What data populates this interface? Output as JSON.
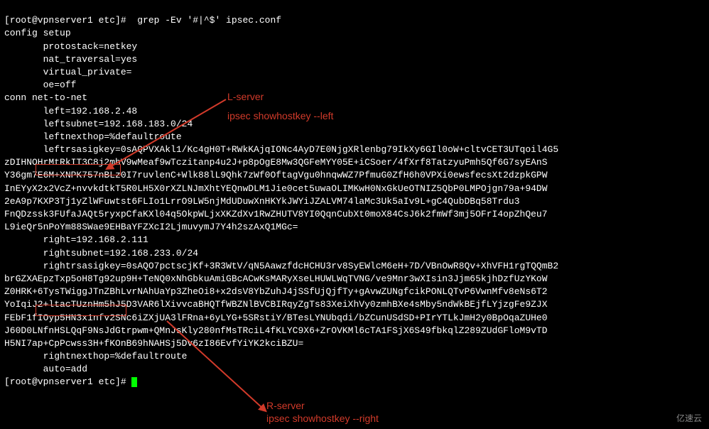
{
  "term": {
    "l0": "[root@vpnserver1 etc]#  grep -Ev '#|^$' ipsec.conf",
    "l1": "config setup",
    "l2": "       protostack=netkey",
    "l3": "       nat_traversal=yes",
    "l4": "       virtual_private=",
    "l5": "       oe=off",
    "l6": "conn net-to-net",
    "l7": "       left=192.168.2.48",
    "l8": "       leftsubnet=192.168.183.0/24",
    "l9": "       leftnexthop=%defaultroute",
    "l10a": "       leftrsasigkey=",
    "l10b": "0sAQPVXAkl1/Kc4gH0T+RWkKAjqIONc4AyD7E0NjgXRlenbg79IkXy6GIl0oW+cltvCET3UTqoil4G5",
    "l11": "zDIHNOHrMtRkIT3C8j2mhV9wMeaf9wTczitanp4u2J+p8pOgE8Mw3QGFeMYY05E+iCSoer/4fXrf8TatzyuPmh5Qf6G7syEAnS",
    "l12": "Y36gm7E6M+XNPK757nBLz0I7ruvlenC+Wlk88lL9Qhk7zWf0OftagVgu0hnqwWZ7PfmuG0ZfH6h0VPXi0ewsfecsXt2dzpkGPW",
    "l13": "InEYyX2x2VcZ+nvvkdtkT5R0LH5X0rXZLNJmXhtYEQnwDLM1Jie0cet5uwaOLIMKwH0NxGkUeOTNIZ5QbP0LMPOjgn79a+94DW",
    "l14": "2eA9p7KXP3Tj1yZlWFuwtst6FLIo1LrrO9LW5njMdUDuwXnHKYkJWYiJZALVM74laMc3Uk5aIv9L+gC4QubDBq58Trdu3",
    "l15": "FnQDzssk3FUfaJAQt5ryxpCfaKXl04q5OkpWLjxXKZdXv1RwZHUTV8YI0QqnCubXt0moX84CsJ6k2fmWf3mj5OFrI4opZhQeu7",
    "l16": "L9ieQr5nPoYm88SWae9EHBaYFZXcI2LjmuvymJ7Y4h2szAxQ1MGc=",
    "l17": "       right=192.168.2.111",
    "l18": "       rightsubnet=192.168.233.0/24",
    "l19a": "       rightrsasigkey=",
    "l19b": "0sAQO7pctscjKf+3R3WtV/qN5AawzfdcHCHU3rv8SyEWlcM6eH+7D/VBnOwR8Qv+XhVFH1rgTQQmB2",
    "l20": "brGZXAEpzTxp5oH8Tg92up9H+TeNQ0xNhGbkuAmiGBcACwKsMARyXseLHUWLWqTVNG/ve9Mnr3wXIsin3Jjm65kjhDzfUzYKoW",
    "l21": "Z0HRK+6TysTWiggJTnZBhLvrNAhUaYp3ZheOi8+x2dsV8YbZuhJ4jSSfUjQjfTy+gAvwZUNgfcikPONLQTvP6VwnMfv8eNs6T2",
    "l22": "YoIqiJ2+ltacTUznHm5hJ5D3VAR6lXivvcaBHQTfWBZNlBVCBIRqyZgTs83XeiXhVy0zmhBXe4sMby5ndWkBEjfLYjzgFe9ZJX",
    "l23": "FEbF1fIOyp5HN3x1nfv2SNc6iZXjUA3lFRna+6yLYG+5SRstiY/BTesLYNUbqdi/bZCunUSdSD+PIrYTLkJmH2y0BpOqaZUHe0",
    "l24": "J60D0LNfnHSLQqF9NsJdGtrpwm+QMnJsKly280nfMsTRciL4fKLYC9X6+ZrOVKMl6cTA1FSjX6S49fbkqlZ289ZUdGFloM9vTD",
    "l25": "H5NI7ap+CpPcwss3H+fKOnB69hNAHSj5Dv6zI86EvfYiYK2kciBZU=",
    "l26": "       rightnexthop=%defaultroute",
    "l27": "       auto=add",
    "l28": "[root@vpnserver1 etc]# "
  },
  "annotations": {
    "l_server": "L-server",
    "l_cmd": "ipsec showhostkey --left",
    "r_server": "R-server",
    "r_cmd": "ipsec showhostkey --right"
  },
  "watermark": "亿速云"
}
